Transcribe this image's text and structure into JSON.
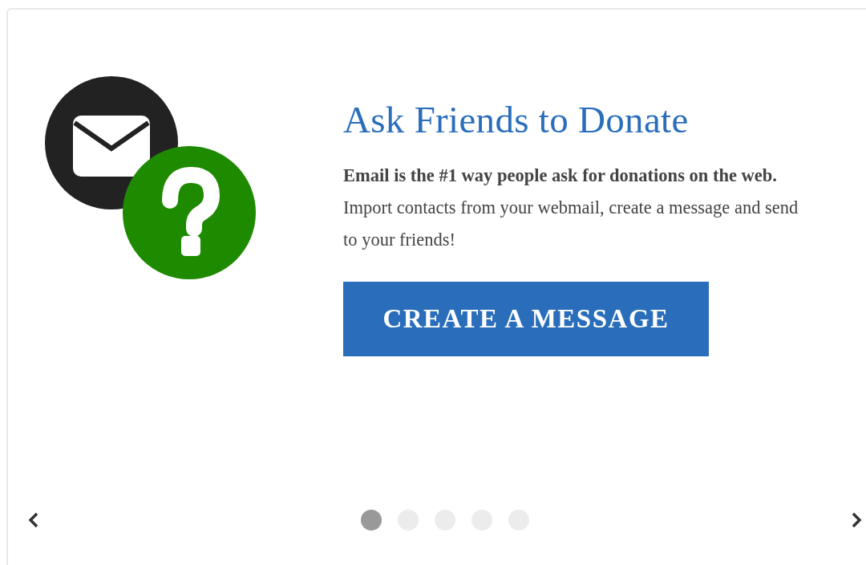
{
  "slide": {
    "title": "Ask Friends to Donate",
    "text": "**Email is the #1 way people ask for donations on the web.** Import contacts from your webmail, create a message and send to your friends!",
    "button": "CREATE A MESSAGE"
  },
  "pager": {
    "dots": [
      {
        "selected": true
      },
      {
        "selected": false
      },
      {
        "selected": false
      },
      {
        "selected": false
      },
      {
        "selected": false
      }
    ]
  }
}
